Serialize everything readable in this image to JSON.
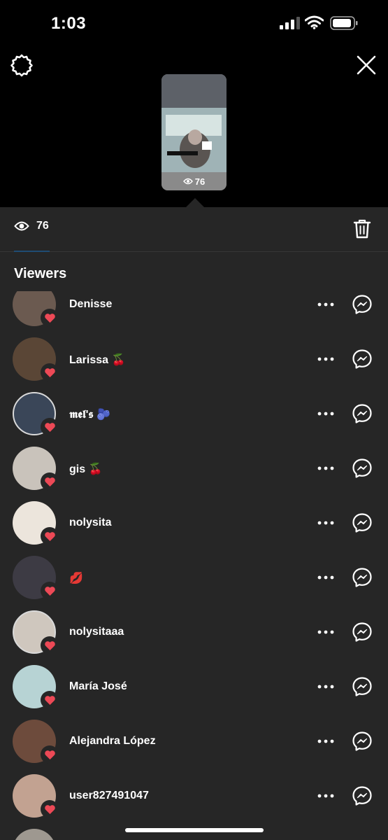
{
  "status_bar": {
    "time": "1:03"
  },
  "story": {
    "view_count": "76"
  },
  "tabs": {
    "views_count": "76"
  },
  "section": {
    "title": "Viewers"
  },
  "viewers": [
    {
      "name": "Denisse",
      "emoji": "",
      "avatar_color": "#6b5a50",
      "liked": true,
      "ring": false
    },
    {
      "name": "Larissa",
      "emoji": "🍒",
      "avatar_color": "#5a4636",
      "liked": true,
      "ring": false
    },
    {
      "name": "𝖒𝖊𝖑'𝖘",
      "emoji": "🫐",
      "avatar_color": "#3a4658",
      "liked": true,
      "ring": true
    },
    {
      "name": "gis",
      "emoji": "🍒",
      "avatar_color": "#c9c3bb",
      "liked": true,
      "ring": false
    },
    {
      "name": "nolysita",
      "emoji": "",
      "avatar_color": "#ece5dc",
      "liked": true,
      "ring": false
    },
    {
      "name": "",
      "emoji": "💋",
      "avatar_color": "#3d3b44",
      "liked": true,
      "ring": false
    },
    {
      "name": "nolysitaaa",
      "emoji": "",
      "avatar_color": "#cfc7be",
      "liked": true,
      "ring": true
    },
    {
      "name": "María José",
      "emoji": "",
      "avatar_color": "#b7d3d4",
      "liked": true,
      "ring": false
    },
    {
      "name": "Alejandra López",
      "emoji": "",
      "avatar_color": "#6d4b3c",
      "liked": true,
      "ring": false
    },
    {
      "name": "user827491047",
      "emoji": "",
      "avatar_color": "#c2a291",
      "liked": true,
      "ring": false
    },
    {
      "name": "",
      "emoji": "",
      "avatar_color": "#9e9890",
      "liked": false,
      "ring": false
    }
  ],
  "colors": {
    "heart": "#ed4956",
    "sheet_bg": "#262626",
    "accent": "#1f4c73"
  },
  "icons": [
    "gear-icon",
    "close-icon",
    "eye-icon",
    "trash-icon",
    "heart-icon",
    "more-icon",
    "messenger-icon"
  ]
}
